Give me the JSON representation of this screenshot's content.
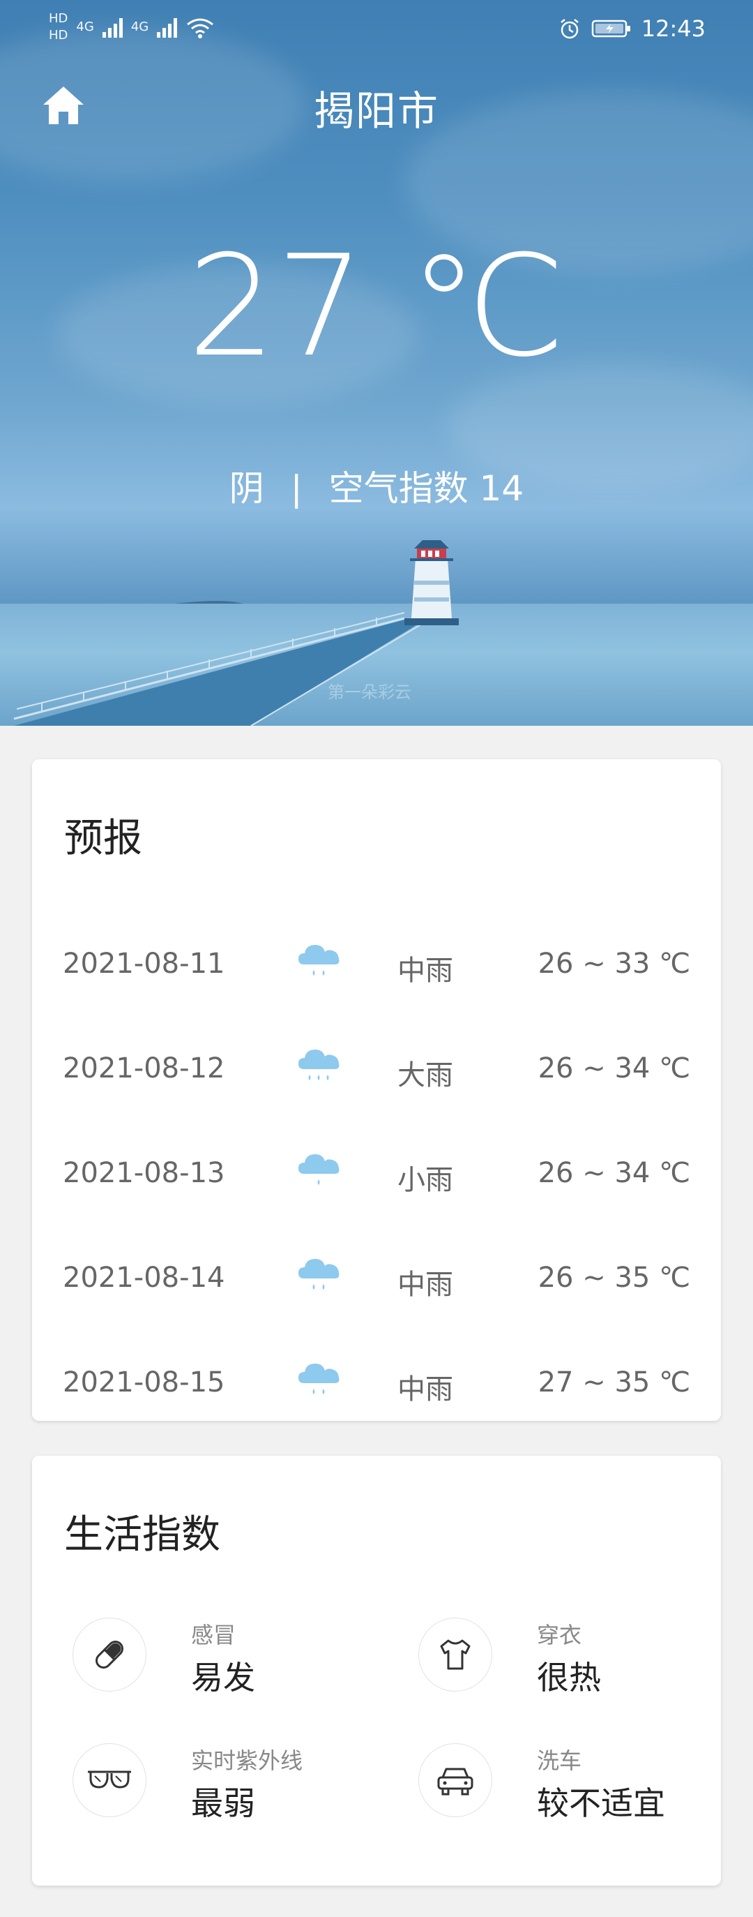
{
  "status_bar": {
    "sim1": "HD",
    "sim2": "HD",
    "net1": "4G",
    "net2": "4G",
    "time": "12:43"
  },
  "header": {
    "city": "揭阳市",
    "temperature": "27 ℃",
    "condition": "阴",
    "separator": "|",
    "aqi": "空气指数 14",
    "watermark": "第一朵彩云"
  },
  "forecast": {
    "title": "预报",
    "days": [
      {
        "date": "2021-08-11",
        "icon": "rain-medium-icon",
        "text": "中雨",
        "range": "26 ~ 33 ℃"
      },
      {
        "date": "2021-08-12",
        "icon": "rain-heavy-icon",
        "text": "大雨",
        "range": "26 ~ 34 ℃"
      },
      {
        "date": "2021-08-13",
        "icon": "rain-light-icon",
        "text": "小雨",
        "range": "26 ~ 34 ℃"
      },
      {
        "date": "2021-08-14",
        "icon": "rain-medium-icon",
        "text": "中雨",
        "range": "26 ~ 35 ℃"
      },
      {
        "date": "2021-08-15",
        "icon": "rain-medium-icon",
        "text": "中雨",
        "range": "27 ~ 35 ℃"
      }
    ]
  },
  "life_index": {
    "title": "生活指数",
    "items": [
      {
        "label": "感冒",
        "value": "易发",
        "icon": "pill-icon"
      },
      {
        "label": "穿衣",
        "value": "很热",
        "icon": "tshirt-icon"
      },
      {
        "label": "实时紫外线",
        "value": "最弱",
        "icon": "sunglasses-icon"
      },
      {
        "label": "洗车",
        "value": "较不适宜",
        "icon": "car-icon"
      }
    ]
  },
  "colors": {
    "sky_top": "#3f7fb3",
    "rain_icon": "#8ec9ee",
    "card_bg": "#ffffff",
    "page_bg": "#f1f1f1"
  }
}
